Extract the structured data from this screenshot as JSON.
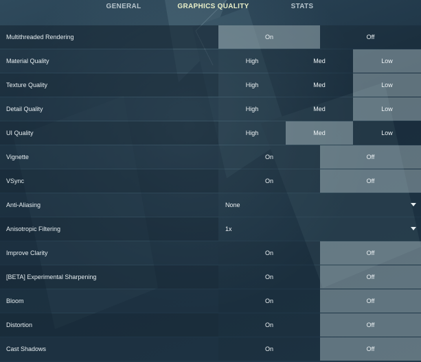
{
  "tabs": [
    {
      "label": "GENERAL",
      "active": false
    },
    {
      "label": "GRAPHICS QUALITY",
      "active": true
    },
    {
      "label": "STATS",
      "active": false
    }
  ],
  "settings": [
    {
      "label": "Multithreaded Rendering",
      "type": "toggle",
      "options": [
        "On",
        "Off"
      ],
      "selected": "On"
    },
    {
      "label": "Material Quality",
      "type": "tri",
      "options": [
        "High",
        "Med",
        "Low"
      ],
      "selected": "Low"
    },
    {
      "label": "Texture Quality",
      "type": "tri",
      "options": [
        "High",
        "Med",
        "Low"
      ],
      "selected": "Low"
    },
    {
      "label": "Detail Quality",
      "type": "tri",
      "options": [
        "High",
        "Med",
        "Low"
      ],
      "selected": "Low"
    },
    {
      "label": "UI Quality",
      "type": "tri",
      "options": [
        "High",
        "Med",
        "Low"
      ],
      "selected": "Med"
    },
    {
      "label": "Vignette",
      "type": "toggle",
      "options": [
        "On",
        "Off"
      ],
      "selected": "Off"
    },
    {
      "label": "VSync",
      "type": "toggle",
      "options": [
        "On",
        "Off"
      ],
      "selected": "Off"
    },
    {
      "label": "Anti-Aliasing",
      "type": "dropdown",
      "value": "None"
    },
    {
      "label": "Anisotropic Filtering",
      "type": "dropdown",
      "value": "1x"
    },
    {
      "label": "Improve Clarity",
      "type": "toggle",
      "options": [
        "On",
        "Off"
      ],
      "selected": "Off"
    },
    {
      "label": "[BETA] Experimental Sharpening",
      "type": "toggle",
      "options": [
        "On",
        "Off"
      ],
      "selected": "Off"
    },
    {
      "label": "Bloom",
      "type": "toggle",
      "options": [
        "On",
        "Off"
      ],
      "selected": "Off"
    },
    {
      "label": "Distortion",
      "type": "toggle",
      "options": [
        "On",
        "Off"
      ],
      "selected": "Off"
    },
    {
      "label": "Cast Shadows",
      "type": "toggle",
      "options": [
        "On",
        "Off"
      ],
      "selected": "Off"
    }
  ],
  "icons": {
    "dropdown_caret": "caret-down-icon"
  },
  "colors": {
    "active_tab": "#e9efc8",
    "selected_option": "#8e9ba2",
    "inactive_tab": "#b7c4cc"
  }
}
